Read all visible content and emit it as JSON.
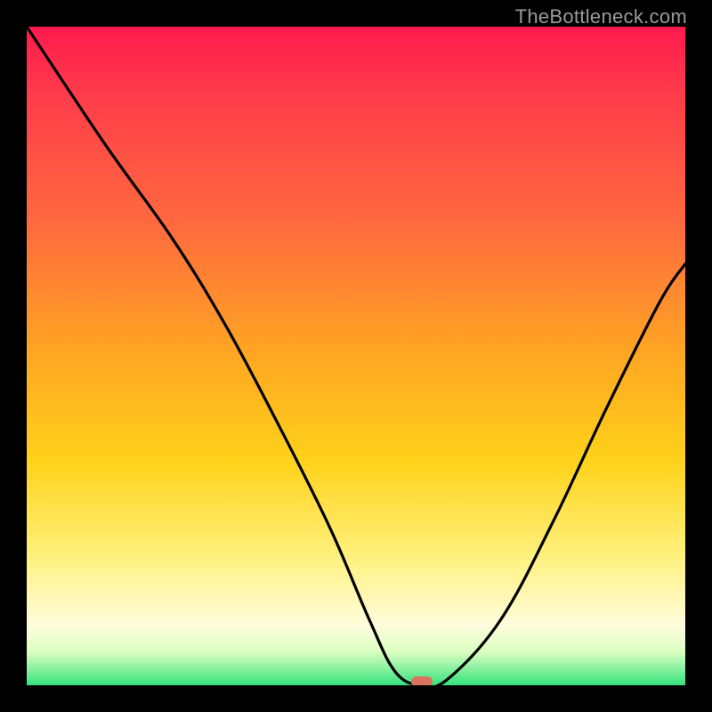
{
  "watermark": "TheBottleneck.com",
  "colors": {
    "frame": "#000000",
    "gradient_top": "#ff1a4d",
    "gradient_bottom": "#35e27d",
    "curve": "#000000",
    "marker": "#d9725f"
  },
  "chart_data": {
    "type": "line",
    "title": "",
    "xlabel": "",
    "ylabel": "",
    "xlim": [
      0,
      100
    ],
    "ylim": [
      0,
      100
    ],
    "grid": false,
    "legend": false,
    "series": [
      {
        "name": "bottleneck-curve",
        "x": [
          0,
          12,
          22,
          30,
          38,
          46,
          52,
          56,
          60,
          64,
          72,
          80,
          88,
          96,
          100
        ],
        "values": [
          100,
          82,
          68,
          55,
          40,
          24,
          10,
          2,
          0,
          1,
          10,
          25,
          42,
          58,
          64
        ]
      }
    ],
    "minimum_marker": {
      "x": 60,
      "y": 0
    }
  }
}
